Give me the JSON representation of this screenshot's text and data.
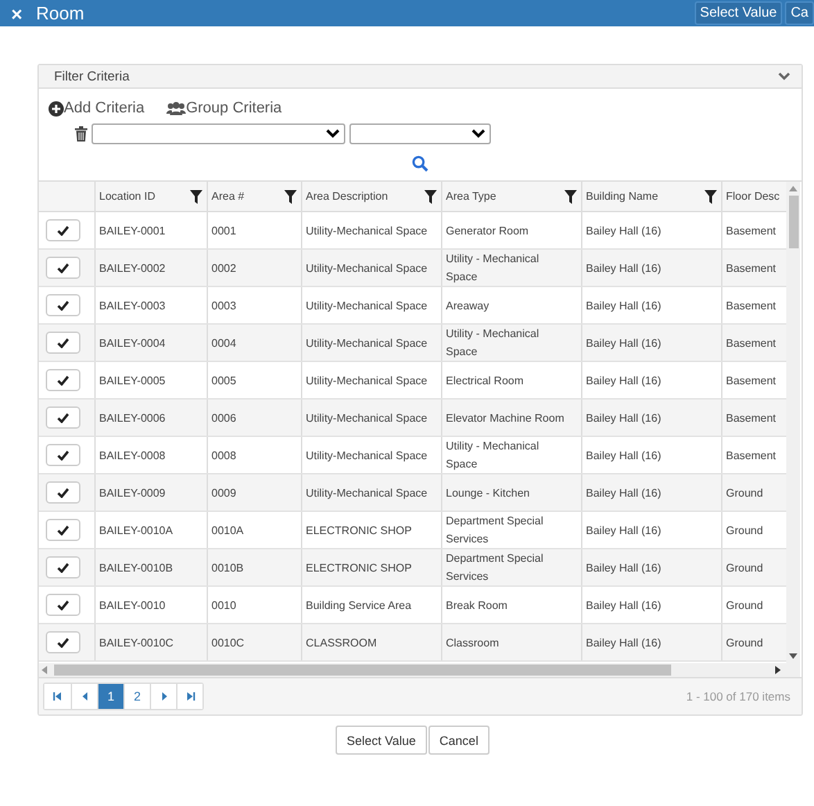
{
  "window": {
    "title": "Room",
    "close_glyph": "×",
    "header_buttons": [
      "Select Value",
      "Ca"
    ]
  },
  "filter": {
    "title": "Filter Criteria",
    "add_label": "Add Criteria",
    "group_label": "Group Criteria"
  },
  "table": {
    "columns": [
      "Location ID",
      "Area #",
      "Area Description",
      "Area Type",
      "Building Name",
      "Floor Desc"
    ],
    "rows": [
      [
        "BAILEY-0001",
        "0001",
        "Utility-Mechanical Space",
        "Generator Room",
        "Bailey Hall (16)",
        "Basement"
      ],
      [
        "BAILEY-0002",
        "0002",
        "Utility-Mechanical Space",
        "Utility - Mechanical Space",
        "Bailey Hall (16)",
        "Basement"
      ],
      [
        "BAILEY-0003",
        "0003",
        "Utility-Mechanical Space",
        "Areaway",
        "Bailey Hall (16)",
        "Basement"
      ],
      [
        "BAILEY-0004",
        "0004",
        "Utility-Mechanical Space",
        "Utility - Mechanical Space",
        "Bailey Hall (16)",
        "Basement"
      ],
      [
        "BAILEY-0005",
        "0005",
        "Utility-Mechanical Space",
        "Electrical Room",
        "Bailey Hall (16)",
        "Basement"
      ],
      [
        "BAILEY-0006",
        "0006",
        "Utility-Mechanical Space",
        "Elevator Machine Room",
        "Bailey Hall (16)",
        "Basement"
      ],
      [
        "BAILEY-0008",
        "0008",
        "Utility-Mechanical Space",
        "Utility - Mechanical Space",
        "Bailey Hall (16)",
        "Basement"
      ],
      [
        "BAILEY-0009",
        "0009",
        "Utility-Mechanical Space",
        "Lounge - Kitchen",
        "Bailey Hall (16)",
        "Ground"
      ],
      [
        "BAILEY-0010A",
        "0010A",
        "ELECTRONIC SHOP",
        "Department Special Services",
        "Bailey Hall (16)",
        "Ground"
      ],
      [
        "BAILEY-0010B",
        "0010B",
        "ELECTRONIC SHOP",
        "Department Special Services",
        "Bailey Hall (16)",
        "Ground"
      ],
      [
        "BAILEY-0010",
        "0010",
        "Building Service Area",
        "Break Room",
        "Bailey Hall (16)",
        "Ground"
      ],
      [
        "BAILEY-0010C",
        "0010C",
        "CLASSROOM",
        "Classroom",
        "Bailey Hall (16)",
        "Ground"
      ]
    ]
  },
  "pager": {
    "pages": [
      {
        "label": "1",
        "selected": true
      },
      {
        "label": "2",
        "selected": false
      }
    ],
    "info": "1 - 100 of 170 items"
  },
  "footer_buttons": [
    "Select Value",
    "Cancel"
  ]
}
